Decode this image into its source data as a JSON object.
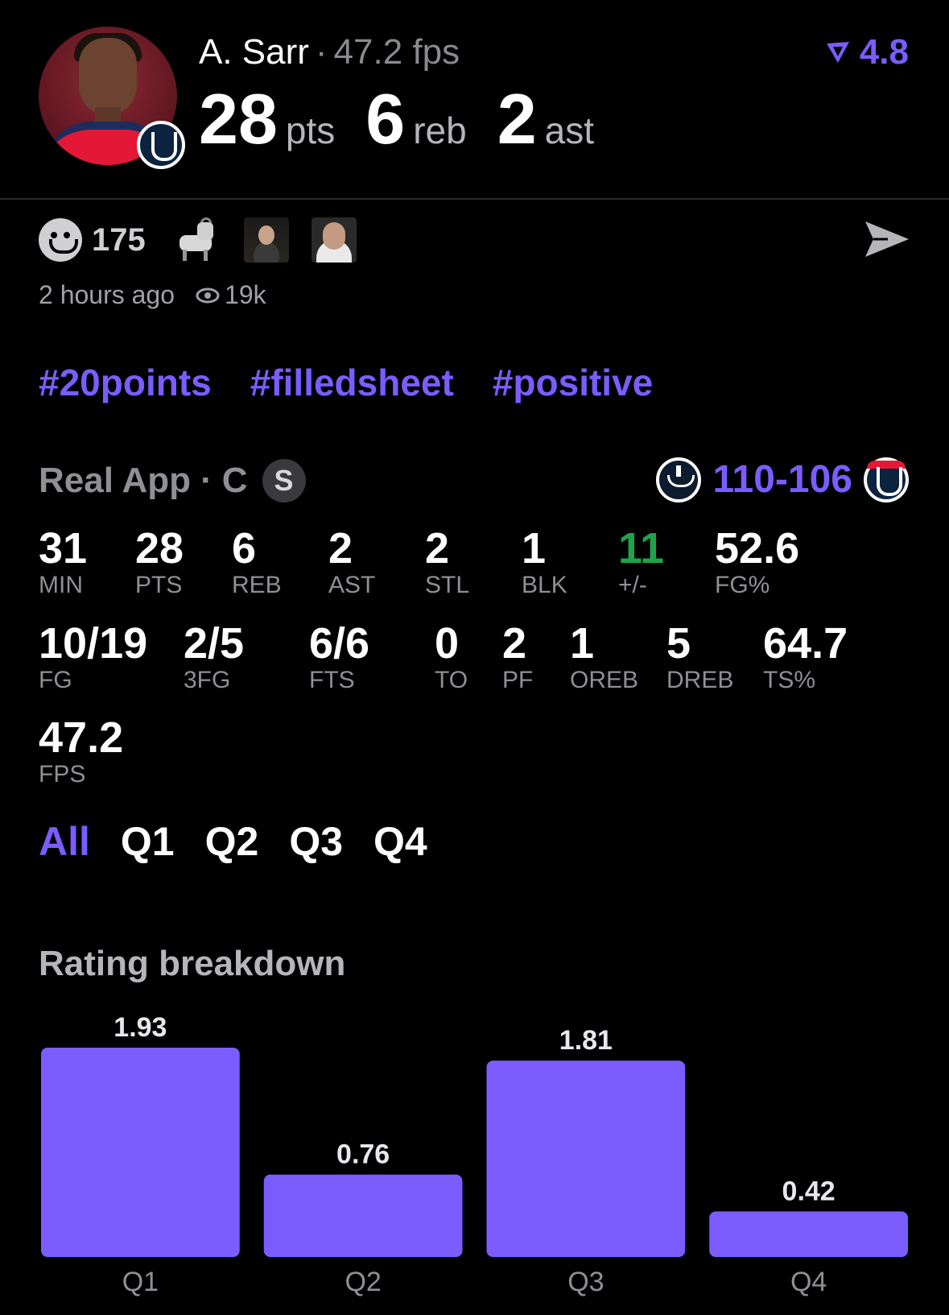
{
  "player": {
    "name": "A. Sarr",
    "fps": "47.2 fps",
    "rating": "4.8",
    "pts": "28",
    "pts_label": "pts",
    "reb": "6",
    "reb_label": "reb",
    "ast": "2",
    "ast_label": "ast"
  },
  "reactions": {
    "count": "175",
    "time": "2 hours ago",
    "views": "19k"
  },
  "hashtags": [
    "#20points",
    "#filledsheet",
    "#positive"
  ],
  "game": {
    "source": "Real App",
    "position": "C",
    "badge": "S",
    "score": "110-106"
  },
  "stats_row1": [
    {
      "value": "31",
      "label": "MIN"
    },
    {
      "value": "28",
      "label": "PTS"
    },
    {
      "value": "6",
      "label": "REB"
    },
    {
      "value": "2",
      "label": "AST"
    },
    {
      "value": "2",
      "label": "STL"
    },
    {
      "value": "1",
      "label": "BLK"
    },
    {
      "value": "11",
      "label": "+/-"
    },
    {
      "value": "52.6",
      "label": "FG%"
    }
  ],
  "stats_row2": [
    {
      "value": "10/19",
      "label": "FG"
    },
    {
      "value": "2/5",
      "label": "3FG"
    },
    {
      "value": "6/6",
      "label": "FTS"
    },
    {
      "value": "0",
      "label": "TO"
    },
    {
      "value": "2",
      "label": "PF"
    },
    {
      "value": "1",
      "label": "OREB"
    },
    {
      "value": "5",
      "label": "DREB"
    },
    {
      "value": "64.7",
      "label": "TS%"
    }
  ],
  "stats_row3": [
    {
      "value": "47.2",
      "label": "FPS"
    }
  ],
  "quarter_tabs": [
    "All",
    "Q1",
    "Q2",
    "Q3",
    "Q4"
  ],
  "active_tab": "All",
  "section_title": "Rating breakdown",
  "colors": {
    "accent": "#7b5cff",
    "positive": "#1fa34a",
    "background": "#000000"
  },
  "chart_data": {
    "type": "bar",
    "categories": [
      "Q1",
      "Q2",
      "Q3",
      "Q4"
    ],
    "values": [
      1.93,
      0.76,
      1.81,
      0.42
    ],
    "title": "Rating breakdown",
    "ylim": [
      0,
      1.93
    ],
    "grid": false
  }
}
